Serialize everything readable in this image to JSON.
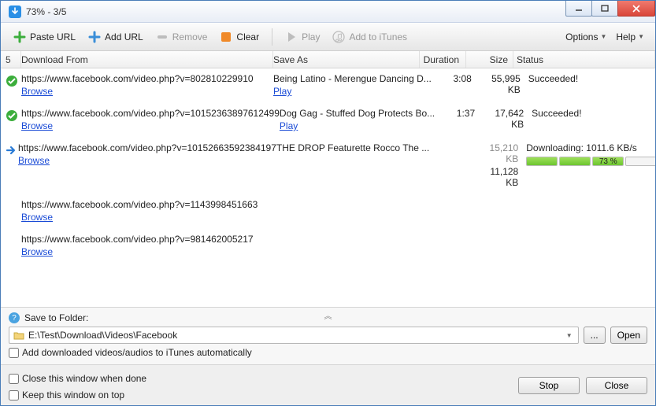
{
  "window": {
    "title": "73% - 3/5"
  },
  "toolbar": {
    "paste_url": "Paste URL",
    "add_url": "Add URL",
    "remove": "Remove",
    "clear": "Clear",
    "play": "Play",
    "add_itunes": "Add to iTunes",
    "options": "Options",
    "help": "Help"
  },
  "columns": {
    "count": "5",
    "from": "Download From",
    "save_as": "Save As",
    "duration": "Duration",
    "size": "Size",
    "status": "Status"
  },
  "rows": [
    {
      "status_icon": "check",
      "url": "https://www.facebook.com/video.php?v=802810229910",
      "browse": "Browse",
      "save_as": "Being Latino - Merengue Dancing D...",
      "play": "Play",
      "duration": "3:08",
      "size": "55,995 KB",
      "status": "Succeeded!"
    },
    {
      "status_icon": "check",
      "url": "https://www.facebook.com/video.php?v=10152363897612499",
      "browse": "Browse",
      "save_as": "Dog Gag - Stuffed Dog Protects Bo...",
      "play": "Play",
      "duration": "1:37",
      "size": "17,642 KB",
      "status": "Succeeded!"
    },
    {
      "status_icon": "arrow",
      "url": "https://www.facebook.com/video.php?v=10152663592384197",
      "browse": "Browse",
      "save_as": "THE DROP Featurette   Rocco The ...",
      "duration": "",
      "size": "15,210 KB",
      "size2": "11,128 KB",
      "status": "Downloading: 1011.6 KB/s",
      "progress_pct": "73 %"
    },
    {
      "status_icon": "",
      "url": "https://www.facebook.com/video.php?v=1143998451663",
      "browse": "Browse"
    },
    {
      "status_icon": "",
      "url": "https://www.facebook.com/video.php?v=981462005217",
      "browse": "Browse"
    }
  ],
  "save": {
    "label": "Save to Folder:",
    "path": "E:\\Test\\Download\\Videos\\Facebook",
    "browse_btn": "...",
    "open_btn": "Open",
    "itunes_chk": "Add downloaded videos/audios to iTunes automatically"
  },
  "footer": {
    "close_when_done": "Close this window when done",
    "keep_on_top": "Keep this window on top",
    "stop": "Stop",
    "close": "Close"
  }
}
